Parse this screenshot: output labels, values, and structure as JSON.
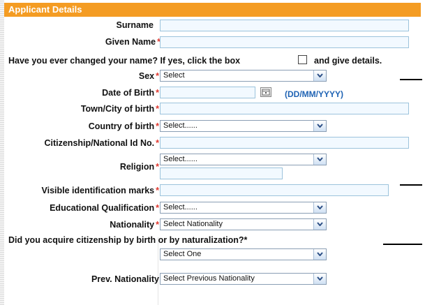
{
  "section": {
    "title": "Applicant Details"
  },
  "fields": {
    "surname": {
      "label": "Surname",
      "value": ""
    },
    "given_name": {
      "label": "Given Name",
      "required_mark": "*",
      "value": ""
    },
    "name_change": {
      "prefix": "Have you ever changed your name? If yes, click the box",
      "suffix": "and give details."
    },
    "sex": {
      "label": "Sex",
      "required_mark": "*",
      "selected": "Select"
    },
    "dob": {
      "label": "Date of Birth",
      "required_mark": "*",
      "value": "",
      "format_hint": "(DD/MM/YYYY)"
    },
    "town_of_birth": {
      "label": "Town/City of birth",
      "required_mark": "*",
      "value": ""
    },
    "country_of_birth": {
      "label": "Country of birth",
      "required_mark": "*",
      "selected": "Select......"
    },
    "citizenship_id": {
      "label": "Citizenship/National Id No.",
      "required_mark": "*",
      "value": ""
    },
    "religion": {
      "label": "Religion",
      "required_mark": "*",
      "selected": "Select......",
      "other_value": ""
    },
    "identification_marks": {
      "label": "Visible identification marks",
      "required_mark": "*",
      "value": ""
    },
    "education": {
      "label": "Educational Qualification",
      "required_mark": "*",
      "selected": "Select......"
    },
    "nationality": {
      "label": "Nationality",
      "required_mark": "*",
      "selected": "Select Nationality"
    },
    "citizenship_acquired": {
      "question": "Did you acquire citizenship by birth or by naturalization?",
      "required_mark": "*",
      "selected": "Select One"
    },
    "prev_nationality": {
      "label": "Prev. Nationality",
      "selected": "Select Previous Nationality"
    }
  },
  "icons": {
    "calendar": "calendar-icon",
    "dropdown": "chevron-down-icon"
  },
  "colors": {
    "header_bg": "#f49c23",
    "required": "#e0382f",
    "hint": "#1f63b4",
    "textbox_bg": "#f2f9ff"
  }
}
